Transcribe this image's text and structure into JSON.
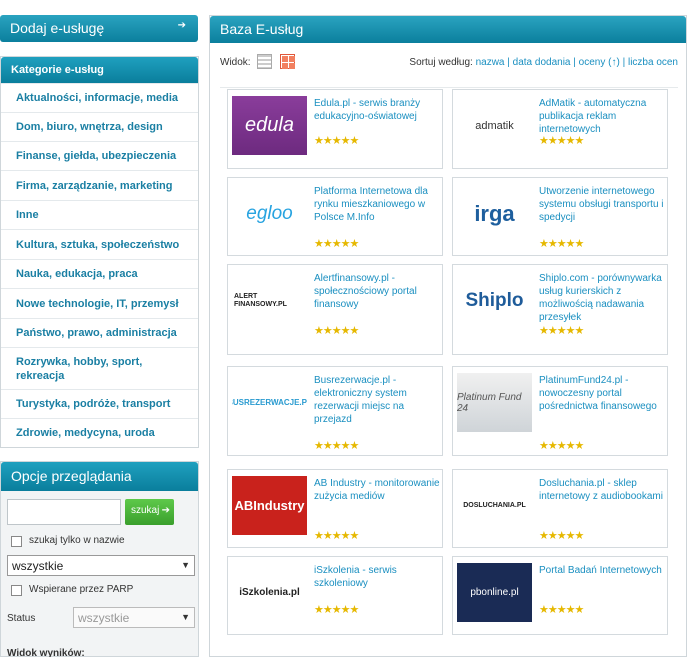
{
  "sidebar": {
    "add_button": "Dodaj e-usługę",
    "add_arrow": "➔",
    "categories_title": "Kategorie e-usług",
    "categories": [
      "Aktualności, informacje, media",
      "Dom, biuro, wnętrza, design",
      "Finanse, giełda, ubezpieczenia",
      "Firma, zarządzanie, marketing",
      "Inne",
      "Kultura, sztuka, społeczeństwo",
      "Nauka, edukacja, praca",
      "Nowe technologie, IT, przemysł",
      "Państwo, prawo, administracja",
      "Rozrywka, hobby, sport, rekreacja",
      "Turystyka, podróże, transport",
      "Zdrowie, medycyna, uroda"
    ]
  },
  "options": {
    "title": "Opcje przeglądania",
    "search_placeholder": "",
    "search_button": "szukaj",
    "search_arrow": "➔",
    "name_only_label": "szukaj tylko w nazwie",
    "scope_select": "wszystkie",
    "parp_label": "Wspierane przez PARP",
    "status_label": "Status",
    "status_select": "wszystkie",
    "results_view_label": "Widok wyników:"
  },
  "main": {
    "title": "Baza E-usług",
    "view_label": "Widok:",
    "sort_label": "Sortuj według:",
    "sort_options": [
      "nazwa",
      "data dodania",
      "oceny (↑)",
      "liczba ocen"
    ],
    "stars": "★★★★★",
    "cards": [
      {
        "logo_text": "edula",
        "logo_icon": "edula-logo",
        "title": "Edula.pl - serwis branży edukacyjno-oświatowej"
      },
      {
        "logo_text": "admatik",
        "logo_icon": "admatik-logo",
        "title": "AdMatik - automatyczna publikacja reklam internetowych"
      },
      {
        "logo_text": "egloo",
        "logo_icon": "egloo-logo",
        "title": "Platforma Internetowa dla rynku mieszkaniowego w Polsce M.Info"
      },
      {
        "logo_text": "irga",
        "logo_icon": "irga-logo",
        "title": "Utworzenie internetowego systemu obsługi transportu i spedycji"
      },
      {
        "logo_text": "ALERT FINANSOWY.PL",
        "logo_icon": "alertfinansowy-logo",
        "title": "Alertfinansowy.pl - społecznościowy portal finansowy"
      },
      {
        "logo_text": "Shiplo",
        "logo_icon": "shiplo-logo",
        "title": "Shiplo.com - porównywarka usług kurierskich z możliwością nadawania przesyłek"
      },
      {
        "logo_text": "BUSREZERWACJE.PL",
        "logo_icon": "busrezerwacje-logo",
        "title": "Busrezerwacje.pl - elektroniczny system rezerwacji miejsc na przejazd"
      },
      {
        "logo_text": "Platinum Fund 24",
        "logo_icon": "platinumfund-logo",
        "title": "PlatinumFund24.pl - nowoczesny portal pośrednictwa finansowego"
      },
      {
        "logo_text": "ABIndustry",
        "logo_icon": "abindustry-logo",
        "title": "AB Industry - monitorowanie zużycia mediów"
      },
      {
        "logo_text": "DOSLUCHANIA.PL",
        "logo_icon": "dosluchania-logo",
        "title": "Dosluchania.pl - sklep internetowy z audiobookami"
      },
      {
        "logo_text": "iSzkolenia.pl",
        "logo_icon": "iszkolenia-logo",
        "title": "iSzkolenia - serwis szkoleniowy"
      },
      {
        "logo_text": "pbonline.pl",
        "logo_icon": "pbonline-logo",
        "title": "Portal Badań Internetowych"
      }
    ]
  },
  "colors": {
    "header": "#0b7f9d",
    "link": "#1a8fc0",
    "category": "#1a7fa3",
    "star": "#e6b800",
    "search_button": "#3a9f2c"
  }
}
